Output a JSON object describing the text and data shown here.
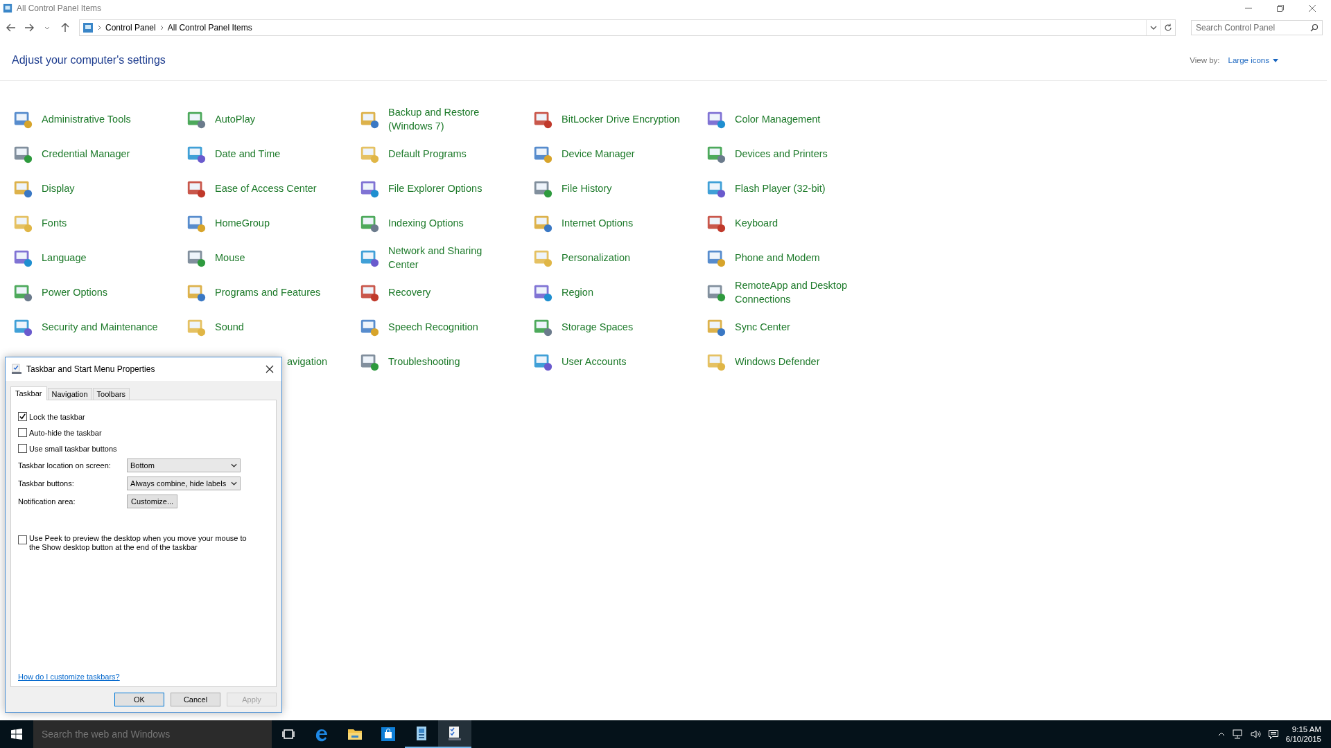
{
  "window": {
    "title": "All Control Panel Items"
  },
  "address": {
    "breadcrumbs": [
      "Control Panel",
      "All Control Panel Items"
    ]
  },
  "search": {
    "placeholder": "Search Control Panel"
  },
  "heading": "Adjust your computer's settings",
  "view_by": {
    "label": "View by:",
    "value": "Large icons"
  },
  "items": [
    {
      "kind": "applet",
      "label": "Administrative Tools"
    },
    {
      "kind": "applet",
      "label": "AutoPlay"
    },
    {
      "kind": "applet",
      "label": "Backup and Restore (Windows 7)"
    },
    {
      "kind": "applet",
      "label": "BitLocker Drive Encryption"
    },
    {
      "kind": "applet",
      "label": "Color Management"
    },
    {
      "kind": "applet",
      "label": "Credential Manager"
    },
    {
      "kind": "applet",
      "label": "Date and Time"
    },
    {
      "kind": "applet",
      "label": "Default Programs"
    },
    {
      "kind": "applet",
      "label": "Device Manager"
    },
    {
      "kind": "applet",
      "label": "Devices and Printers"
    },
    {
      "kind": "applet",
      "label": "Display"
    },
    {
      "kind": "applet",
      "label": "Ease of Access Center"
    },
    {
      "kind": "applet",
      "label": "File Explorer Options"
    },
    {
      "kind": "applet",
      "label": "File History"
    },
    {
      "kind": "applet",
      "label": "Flash Player (32-bit)"
    },
    {
      "kind": "applet",
      "label": "Fonts"
    },
    {
      "kind": "applet",
      "label": "HomeGroup"
    },
    {
      "kind": "applet",
      "label": "Indexing Options"
    },
    {
      "kind": "applet",
      "label": "Internet Options"
    },
    {
      "kind": "applet",
      "label": "Keyboard"
    },
    {
      "kind": "applet",
      "label": "Language"
    },
    {
      "kind": "applet",
      "label": "Mouse"
    },
    {
      "kind": "applet",
      "label": "Network and Sharing Center"
    },
    {
      "kind": "applet",
      "label": "Personalization"
    },
    {
      "kind": "applet",
      "label": "Phone and Modem"
    },
    {
      "kind": "applet",
      "label": "Power Options"
    },
    {
      "kind": "applet",
      "label": "Programs and Features"
    },
    {
      "kind": "applet",
      "label": "Recovery"
    },
    {
      "kind": "applet",
      "label": "Region"
    },
    {
      "kind": "applet",
      "label": "RemoteApp and Desktop Connections"
    },
    {
      "kind": "applet",
      "label": "Security and Maintenance"
    },
    {
      "kind": "applet",
      "label": "Sound"
    },
    {
      "kind": "applet",
      "label": "Speech Recognition"
    },
    {
      "kind": "applet",
      "label": "Storage Spaces"
    },
    {
      "kind": "applet",
      "label": "Sync Center"
    },
    {
      "kind": "hidden"
    },
    {
      "kind": "covered",
      "label": "avigation"
    },
    {
      "kind": "applet",
      "label": "Troubleshooting"
    },
    {
      "kind": "applet",
      "label": "User Accounts"
    },
    {
      "kind": "applet",
      "label": "Windows Defender"
    }
  ],
  "dialog": {
    "title": "Taskbar and Start Menu Properties",
    "tabs": [
      {
        "label": "Taskbar",
        "selected": true
      },
      {
        "label": "Navigation",
        "selected": false
      },
      {
        "label": "Toolbars",
        "selected": false
      }
    ],
    "checkboxes": [
      {
        "label": "Lock the taskbar",
        "checked": true
      },
      {
        "label": "Auto-hide the taskbar",
        "checked": false
      },
      {
        "label": "Use small taskbar buttons",
        "checked": false
      }
    ],
    "fields": [
      {
        "kind": "dropdown",
        "label": "Taskbar location on screen:",
        "value": "Bottom"
      },
      {
        "kind": "dropdown",
        "label": "Taskbar buttons:",
        "value": "Always combine, hide labels"
      },
      {
        "kind": "button",
        "label": "Notification area:",
        "value": "Customize..."
      }
    ],
    "peek": {
      "label": "Use Peek to preview the desktop when you move your mouse to the Show desktop button at the end of the taskbar",
      "checked": false
    },
    "help_link": "How do I customize taskbars?",
    "buttons": [
      {
        "label": "OK",
        "disabled": false
      },
      {
        "label": "Cancel",
        "disabled": false
      },
      {
        "label": "Apply",
        "disabled": true
      }
    ]
  },
  "taskbar": {
    "search_placeholder": "Search the web and Windows",
    "apps": [
      {
        "kind": "task-view",
        "running": false,
        "selected": false
      },
      {
        "kind": "edge",
        "running": false,
        "selected": false
      },
      {
        "kind": "explorer",
        "running": false,
        "selected": false
      },
      {
        "kind": "store",
        "running": false,
        "selected": false
      },
      {
        "kind": "control-panel",
        "running": true,
        "selected": false
      },
      {
        "kind": "taskbar-properties",
        "running": true,
        "selected": true
      }
    ],
    "time": "9:15 AM",
    "date": "6/10/2015"
  }
}
